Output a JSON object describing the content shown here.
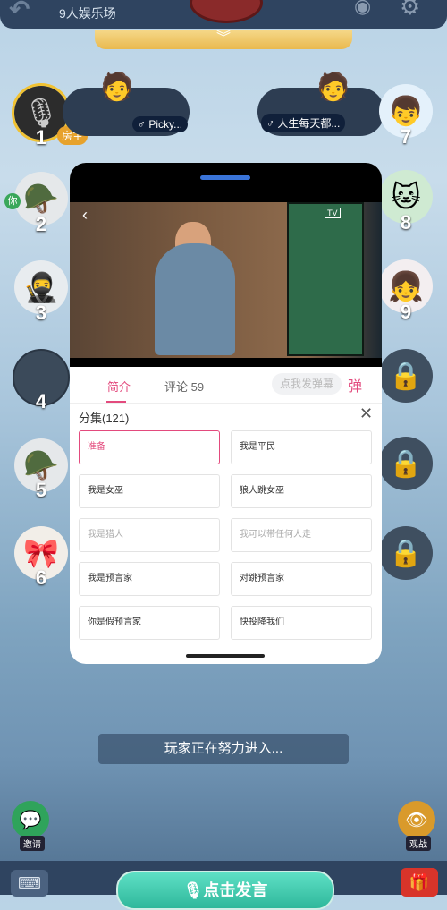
{
  "header": {
    "room_name": "9人娱乐场",
    "expand_icon": "chevron-double-down-icon"
  },
  "seats": [
    {
      "num": "1",
      "host_tag": "房主"
    },
    {
      "num": "2",
      "you_tag": "你"
    },
    {
      "num": "3"
    },
    {
      "num": "4"
    },
    {
      "num": "5"
    },
    {
      "num": "6"
    },
    {
      "num": "7"
    },
    {
      "num": "8"
    },
    {
      "num": "9"
    }
  ],
  "speech_left": {
    "name": "♂ Picky..."
  },
  "speech_right": {
    "name": "♂ 人生每天都..."
  },
  "card": {
    "tabs": [
      "简介",
      "评论 59"
    ],
    "danmu_placeholder": "点我发弹幕",
    "danmu_icon_text": "弹",
    "tv_label": "TV",
    "episodes_title": "分集(121)",
    "episodes": [
      "准备",
      "我是平民",
      "我是女巫",
      "狼人跳女巫",
      "我是猎人",
      "我可以带任何人走",
      "我是预言家",
      "对跳预言家",
      "你是假预言家",
      "快投降我们"
    ]
  },
  "footer": {
    "status": "玩家正在努力进入...",
    "invite_label": "邀请",
    "watch_label": "观战",
    "speak_label": "点击发言"
  },
  "colors": {
    "accent": "#e34a7d",
    "gold": "#e9b94f",
    "speak": "#2fb89b"
  }
}
